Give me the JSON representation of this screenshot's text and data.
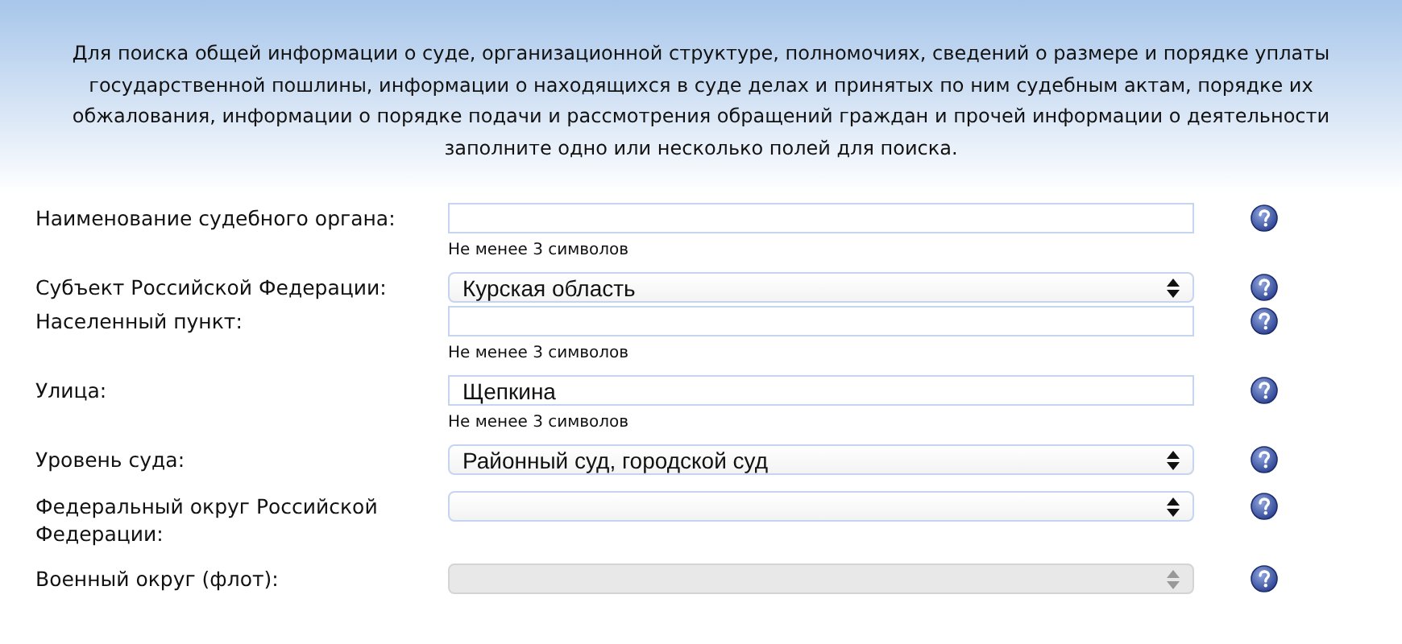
{
  "intro": "Для поиска общей информации о суде, организационной структуре, полномочиях, сведений о размере и порядке уплаты государственной пошлины, информации о находящихся в суде делах и принятых по ним судебным актам, порядке их обжалования, информации о порядке подачи и рассмотрения обращений граждан и прочей информации о деятельности заполните одно или несколько полей для поиска.",
  "fields": [
    {
      "label": "Наименование судебного органа:",
      "kind": "text",
      "hint": "Не менее 3 символов",
      "disabled": false
    },
    {
      "label": "Субъект Российской Федерации:",
      "kind": "select",
      "value": "Курская область",
      "disabled": false
    },
    {
      "label": "Населенный пункт:",
      "kind": "text",
      "hint": "Не менее 3 символов",
      "disabled": false
    },
    {
      "label": "Улица:",
      "kind": "text",
      "value": "Щепкина",
      "hint": "Не менее 3 символов",
      "disabled": false
    },
    {
      "label": "Уровень суда:",
      "kind": "select",
      "value": "Районный суд, городской суд",
      "disabled": false
    },
    {
      "label": "Федеральный округ Российской Федерации:",
      "kind": "select",
      "disabled": false
    },
    {
      "label": "Военный округ (флот):",
      "kind": "select",
      "disabled": true
    }
  ]
}
